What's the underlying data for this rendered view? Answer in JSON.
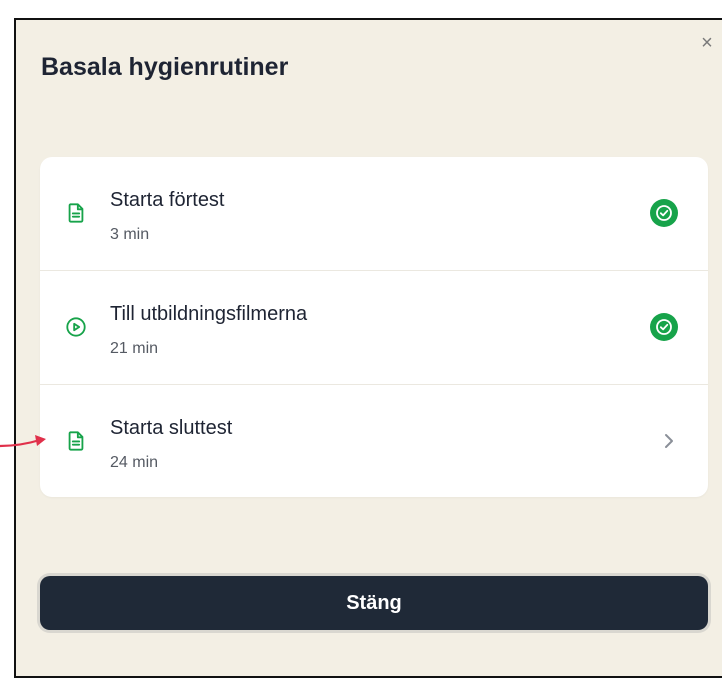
{
  "dialog": {
    "title": "Basala hygienrutiner",
    "close_icon": "×"
  },
  "items": [
    {
      "label": "Starta förtest",
      "duration": "3 min",
      "icon": "document-icon",
      "status": "completed"
    },
    {
      "label": "Till utbildningsfilmerna",
      "duration": "21 min",
      "icon": "play-circle-icon",
      "status": "completed"
    },
    {
      "label": "Starta sluttest",
      "duration": "24 min",
      "icon": "document-icon",
      "status": "chevron"
    }
  ],
  "footer": {
    "close_label": "Stäng"
  },
  "colors": {
    "accent_green": "#17a34a",
    "background": "#f3efe4",
    "button": "#1f2937",
    "annotation_arrow": "#e0304a"
  }
}
